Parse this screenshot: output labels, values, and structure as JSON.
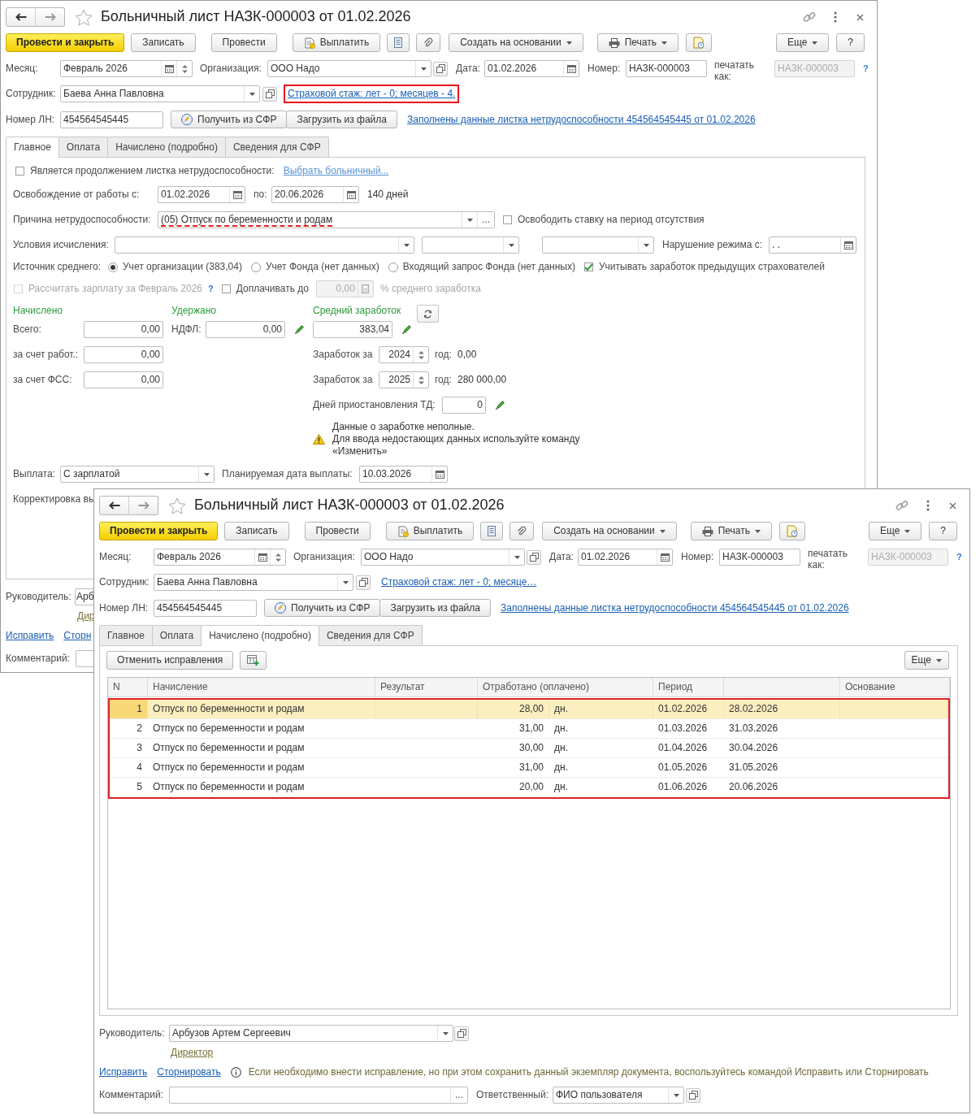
{
  "back_window": {
    "title": "Больничный лист НАЗК-000003 от 01.02.2026",
    "toolbar": [
      {
        "kind": "primary",
        "label": "Провести и закрыть"
      },
      {
        "kind": "text",
        "label": "Записать"
      },
      {
        "kind": "text",
        "label": "Провести"
      },
      {
        "kind": "icon-text",
        "label": "Выплатить"
      },
      {
        "kind": "icon"
      },
      {
        "kind": "icon"
      },
      {
        "kind": "menu",
        "label": "Создать на основании"
      },
      {
        "kind": "icon-menu",
        "label": "Печать"
      },
      {
        "kind": "icon"
      }
    ],
    "toolbar_right": [
      {
        "kind": "menu",
        "label": "Еще"
      },
      {
        "kind": "text",
        "label": "?"
      }
    ],
    "month": {
      "label": "Месяц:",
      "value": "Февраль 2026"
    },
    "organization": {
      "label": "Организация:",
      "value": "ООО Надо"
    },
    "date": {
      "label": "Дата:",
      "value": "01.02.2026"
    },
    "number": {
      "label": "Номер:",
      "value": "НАЗК-000003"
    },
    "print_as": {
      "label": "печатать как:",
      "value": "НАЗК-000003",
      "disabled": true
    },
    "help": "?",
    "employee": {
      "label": "Сотрудник:",
      "value": "Баева Анна Павловна"
    },
    "insurance_link": {
      "text": "Страховой стаж: лет - 0; месяцев - 4.",
      "highlighted": true
    },
    "ln_number": {
      "label": "Номер ЛН:",
      "value": "454564545445"
    },
    "sfr_buttons": [
      "Получить из СФР",
      "Загрузить из файла"
    ],
    "filled_link": "Заполнены данные листка нетрудоспособности 454564545445 от 01.02.2026",
    "tabs": [
      {
        "label": "Главное",
        "selected": true
      },
      {
        "label": "Оплата",
        "selected": false
      },
      {
        "label": "Начислено (подробно)",
        "selected": false
      },
      {
        "label": "Сведения для СФР",
        "selected": false
      }
    ],
    "main_tab": {
      "continuation": {
        "label": "Является продолжением листка нетрудоспособности:",
        "checked": false,
        "link": "Выбрать больничный..."
      },
      "release": {
        "label": "Освобождение от работы с:",
        "from": "01.02.2026",
        "to_label": "по:",
        "to": "20.06.2026",
        "days": "140 дней"
      },
      "reason": {
        "label": "Причина нетрудоспособности:",
        "value": "(05) Отпуск по беременности и родам",
        "highlighted": true,
        "select_button": "..."
      },
      "free_rate": {
        "label": "Освободить ставку на период отсутствия",
        "checked": false
      },
      "conditions": {
        "label": "Условия исчисления:"
      },
      "violation": {
        "label": "Нарушение режима с:",
        "value": ". ."
      },
      "average_source": {
        "label": "Источник среднего:",
        "options": [
          {
            "label": "Учет организации (383,04)",
            "selected": true
          },
          {
            "label": "Учет Фонда (нет данных)",
            "selected": false
          },
          {
            "label": "Входящий запрос Фонда (нет данных)",
            "selected": false
          }
        ]
      },
      "previous_insurers": {
        "label": "Учитывать заработок предыдущих страхователей",
        "checked": true
      },
      "recalc": {
        "label": "Рассчитать зарплату за Февраль 2026",
        "checked": false,
        "disabled": true,
        "help": "?"
      },
      "topup": {
        "label": "Доплачивать до",
        "checked": false,
        "value": "0,00",
        "disabled": true,
        "suffix": "% среднего заработка"
      },
      "accrued": {
        "title": "Начислено",
        "rows": [
          {
            "label": "Всего:",
            "value": "0,00"
          },
          {
            "label": "за счет работ.:",
            "value": "0,00"
          },
          {
            "label": "за счет ФСС:",
            "value": "0,00"
          }
        ]
      },
      "withheld": {
        "title": "Удержано",
        "rows": [
          {
            "label": "НДФЛ:",
            "value": "0,00"
          }
        ]
      },
      "average": {
        "title": "Средний заработок",
        "value": "383,04",
        "years": [
          {
            "label": "Заработок за",
            "year": "2024",
            "year_label": "год:",
            "amount": "0,00"
          },
          {
            "label": "Заработок за",
            "year": "2025",
            "year_label": "год:",
            "amount": "280 000,00"
          }
        ],
        "suspended": {
          "label": "Дней приостановления ТД:",
          "value": "0"
        },
        "warning": [
          "Данные о заработке неполные.",
          "Для ввода недостающих данных используйте команду",
          "«Изменить»"
        ]
      },
      "payment": {
        "label": "Выплата:",
        "value": "С зарплатой"
      },
      "planned_date": {
        "label": "Планируемая дата выплаты:",
        "value": "10.03.2026"
      },
      "correction_label": "Корректировка вы"
    },
    "manager": {
      "label": "Руководитель:",
      "value": "Арб"
    },
    "position_link": "Дир",
    "fix_links": [
      "Исправить",
      "Сторн"
    ],
    "comment": {
      "label": "Комментарий:"
    }
  },
  "front_window": {
    "title": "Больничный лист НАЗК-000003 от 01.02.2026",
    "toolbar": [
      {
        "kind": "primary",
        "label": "Провести и закрыть"
      },
      {
        "kind": "text",
        "label": "Записать"
      },
      {
        "kind": "text",
        "label": "Провести"
      },
      {
        "kind": "icon-text",
        "label": "Выплатить"
      },
      {
        "kind": "icon"
      },
      {
        "kind": "icon"
      },
      {
        "kind": "menu",
        "label": "Создать на основании"
      },
      {
        "kind": "icon-menu",
        "label": "Печать"
      },
      {
        "kind": "icon"
      }
    ],
    "toolbar_right": [
      {
        "kind": "menu",
        "label": "Еще"
      },
      {
        "kind": "text",
        "label": "?"
      }
    ],
    "month": {
      "label": "Месяц:",
      "value": "Февраль 2026"
    },
    "organization": {
      "label": "Организация:",
      "value": "ООО Надо"
    },
    "date": {
      "label": "Дата:",
      "value": "01.02.2026"
    },
    "number": {
      "label": "Номер:",
      "value": "НАЗК-000003"
    },
    "print_as": {
      "label": "печатать как:",
      "value": "НАЗК-000003",
      "disabled": true
    },
    "help": "?",
    "employee": {
      "label": "Сотрудник:",
      "value": "Баева Анна Павловна"
    },
    "insurance_link": {
      "text": "Страховой стаж: лет - 0; месяце…",
      "highlighted": false
    },
    "ln_number": {
      "label": "Номер ЛН:",
      "value": "454564545445"
    },
    "sfr_buttons": [
      "Получить из СФР",
      "Загрузить из файла"
    ],
    "filled_link": "Заполнены данные листка нетрудоспособности 454564545445 от 01.02.2026",
    "tabs": [
      {
        "label": "Главное",
        "selected": false
      },
      {
        "label": "Оплата",
        "selected": false
      },
      {
        "label": "Начислено (подробно)",
        "selected": true
      },
      {
        "label": "Сведения для СФР",
        "selected": false
      }
    ],
    "accruals_tab": {
      "cancel_button": "Отменить исправления",
      "more": "Еще",
      "columns": [
        "N",
        "Начисление",
        "Результат",
        "Отработано (оплачено)",
        "Период",
        "Основание"
      ],
      "highlighted": true,
      "rows": [
        {
          "n": "1",
          "accrual": "Отпуск по беременности и родам",
          "worked": "28,00",
          "unit": "дн.",
          "start": "01.02.2026",
          "end": "28.02.2026",
          "selected": true
        },
        {
          "n": "2",
          "accrual": "Отпуск по беременности и родам",
          "worked": "31,00",
          "unit": "дн.",
          "start": "01.03.2026",
          "end": "31.03.2026",
          "selected": false
        },
        {
          "n": "3",
          "accrual": "Отпуск по беременности и родам",
          "worked": "30,00",
          "unit": "дн.",
          "start": "01.04.2026",
          "end": "30.04.2026",
          "selected": false
        },
        {
          "n": "4",
          "accrual": "Отпуск по беременности и родам",
          "worked": "31,00",
          "unit": "дн.",
          "start": "01.05.2026",
          "end": "31.05.2026",
          "selected": false
        },
        {
          "n": "5",
          "accrual": "Отпуск по беременности и родам",
          "worked": "20,00",
          "unit": "дн.",
          "start": "01.06.2026",
          "end": "20.06.2026",
          "selected": false
        }
      ]
    },
    "manager": {
      "label": "Руководитель:",
      "value": "Арбузов Артем Сергеевич"
    },
    "position_link": "Директор",
    "fix_links": [
      "Исправить",
      "Сторнировать"
    ],
    "note": "Если необходимо внести исправление, но при этом сохранить данный экземпляр документа, воспользуйтесь командой Исправить или Сторнировать",
    "comment": {
      "label": "Комментарий:",
      "select_button": "..."
    },
    "responsible": {
      "label": "Ответственный:",
      "value": "ФИО пользователя"
    }
  }
}
